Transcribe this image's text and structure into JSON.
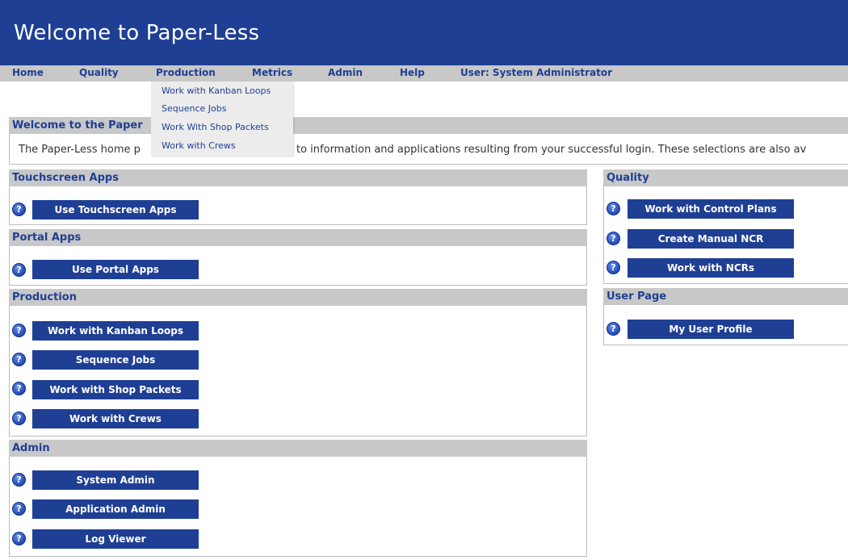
{
  "app": {
    "title": "Welcome to Paper-Less"
  },
  "nav": {
    "items": [
      "Home",
      "Quality",
      "Production",
      "Metrics",
      "Admin",
      "Help"
    ],
    "user": "User: System Administrator"
  },
  "dropdown": {
    "parent": "Production",
    "items": [
      "Work with Kanban Loops",
      "Sequence Jobs",
      "Work With Shop Packets",
      "Work with Crews"
    ]
  },
  "welcome": {
    "title": "Welcome to the Paper",
    "text_before": "The Paper-Less home p",
    "text_after": "to information and applications resulting from your successful login. These selections are also av"
  },
  "help_glyph": "?",
  "sections": {
    "touchscreen": {
      "title": "Touchscreen Apps",
      "buttons": [
        "Use Touchscreen Apps"
      ]
    },
    "portal": {
      "title": "Portal Apps",
      "buttons": [
        "Use Portal Apps"
      ]
    },
    "production": {
      "title": "Production",
      "buttons": [
        "Work with Kanban Loops",
        "Sequence Jobs",
        "Work with Shop Packets",
        "Work with Crews"
      ]
    },
    "admin": {
      "title": "Admin",
      "buttons": [
        "System Admin",
        "Application Admin",
        "Log Viewer"
      ]
    },
    "quality": {
      "title": "Quality",
      "buttons": [
        "Work with Control Plans",
        "Create Manual NCR",
        "Work with NCRs"
      ]
    },
    "user_page": {
      "title": "User Page",
      "buttons": [
        "My User Profile"
      ]
    }
  },
  "colors": {
    "brand": "#1f3f94",
    "bar": "#c8c8c8",
    "dropdown_bg": "#ececec"
  },
  "icons": {
    "help": "help-circle-icon"
  }
}
